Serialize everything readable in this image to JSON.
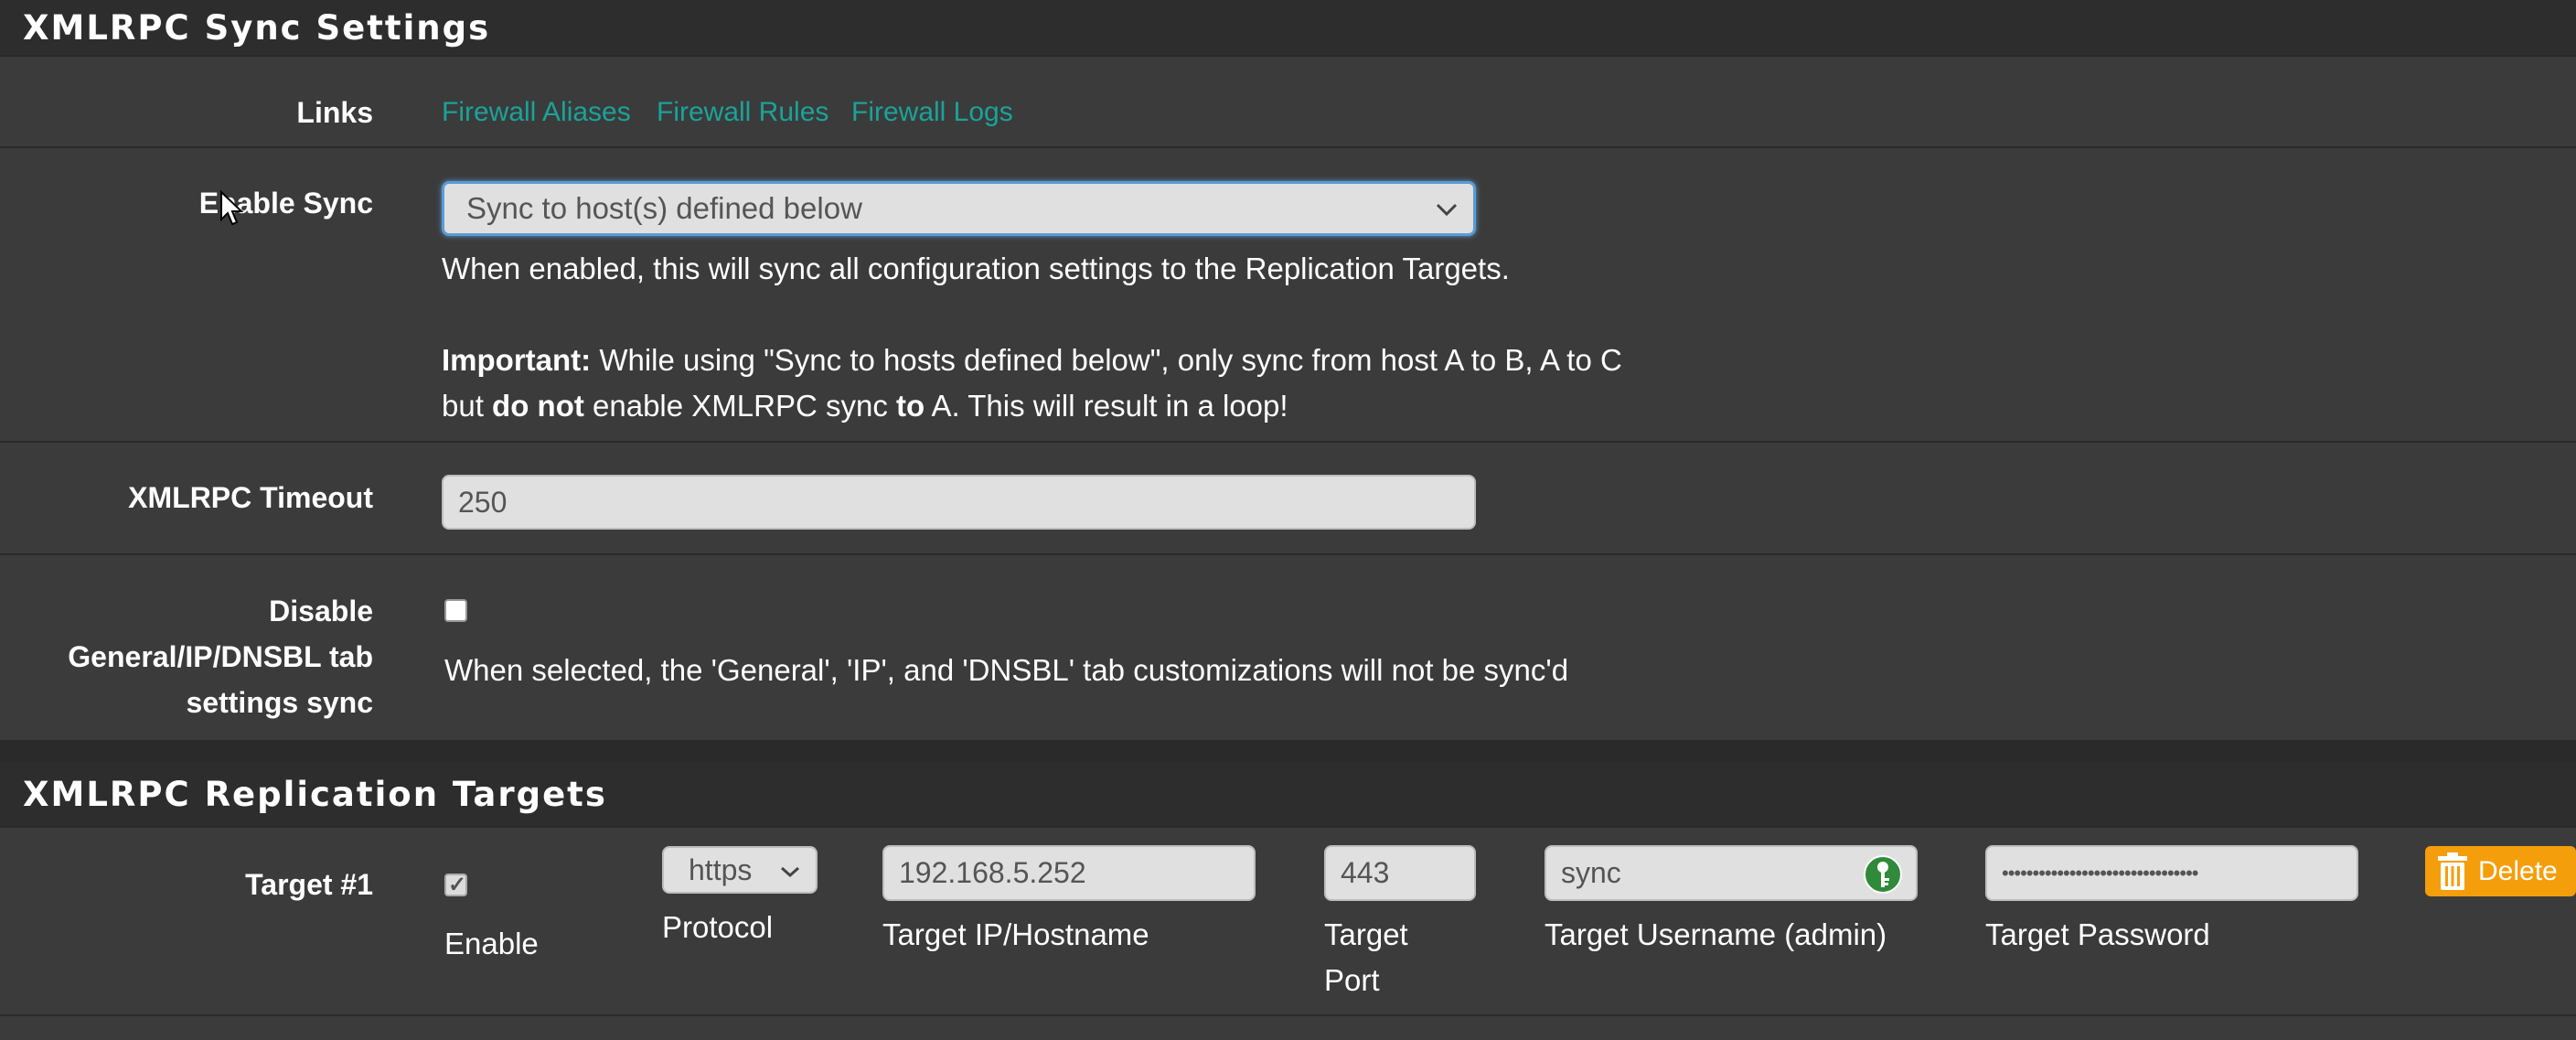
{
  "sync_panel": {
    "title": "XMLRPC Sync Settings",
    "links_label": "Links",
    "links": [
      "Firewall Aliases",
      "Firewall Rules",
      "Firewall Logs"
    ],
    "enable_sync_label": "Enable Sync",
    "enable_sync_value": "Sync to host(s) defined below",
    "enable_help_1": "When enabled, this will sync all configuration settings to the Replication Targets.",
    "important_label": "Important:",
    "important_text_1": " While using \"Sync to hosts defined below\", only sync from host A to B, A to C",
    "important_text_2a": "but ",
    "important_do_not": "do not",
    "important_text_2b": " enable XMLRPC sync ",
    "important_to": "to",
    "important_text_2c": " A. This will result in a loop!",
    "timeout_label": "XMLRPC Timeout",
    "timeout_value": "250",
    "disable_label_1": "Disable",
    "disable_label_2": "General/IP/DNSBL tab",
    "disable_label_3": "settings sync",
    "disable_checked": false,
    "disable_help": "When selected, the 'General', 'IP', and 'DNSBL' tab customizations will not be sync'd"
  },
  "targets_panel": {
    "title": "XMLRPC Replication Targets",
    "target_label": "Target #1",
    "enable_checked": true,
    "enable_label": "Enable",
    "protocol_value": "https",
    "protocol_label": "Protocol",
    "host_value": "192.168.5.252",
    "host_label": "Target IP/Hostname",
    "port_value": "443",
    "port_label_1": "Target",
    "port_label_2": "Port",
    "username_value": "sync",
    "username_label": "Target Username (admin)",
    "password_value": "••••••••••••••••••••••••••••••••",
    "password_label": "Target Password",
    "delete_label": "Delete"
  },
  "colors": {
    "link": "#1aa39a",
    "delete": "#f59e0b",
    "focus": "#5b9bd5"
  }
}
